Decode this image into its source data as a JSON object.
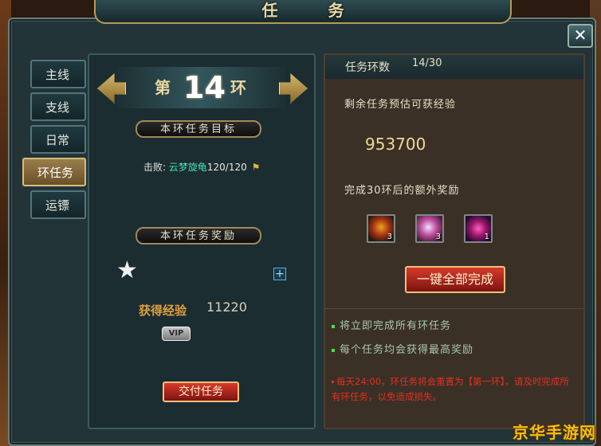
{
  "window": {
    "title": "任 务",
    "close_label": "✕"
  },
  "tabs": [
    {
      "label": "主线",
      "active": false
    },
    {
      "label": "支线",
      "active": false
    },
    {
      "label": "日常",
      "active": false
    },
    {
      "label": "环任务",
      "active": true
    },
    {
      "label": "运镖",
      "active": false
    }
  ],
  "ring": {
    "prefix": "第",
    "number": "14",
    "suffix": "环"
  },
  "objective": {
    "header": "本环任务目标",
    "action": "击败:",
    "target": "云梦旋龟",
    "progress": "120/120"
  },
  "reward": {
    "header": "本环任务奖励",
    "exp_label": "获得经验",
    "exp_value": "11220",
    "vip_label": "VIP",
    "submit_button": "交付任务"
  },
  "summary": {
    "ring_count_label": "任务环数",
    "ring_count_value": "14/30",
    "remaining_exp_label": "剩余任务预估可获经验",
    "remaining_exp_value": "953700",
    "extra_reward_label": "完成30环后的额外奖励",
    "items": [
      {
        "icon": "fire-crystal-icon",
        "count": "3"
      },
      {
        "icon": "pink-crystal-icon",
        "count": "3"
      },
      {
        "icon": "magic-orb-icon",
        "count": "1"
      }
    ],
    "complete_all_button": "一键全部完成",
    "bullets": [
      "将立即完成所有环任务",
      "每个任务均会获得最高奖励"
    ],
    "notice": "每天24:00，环任务将会重置为【第一环】，请及时完成所有环任务，以免造成损失。"
  },
  "watermark": "京华手游网"
}
